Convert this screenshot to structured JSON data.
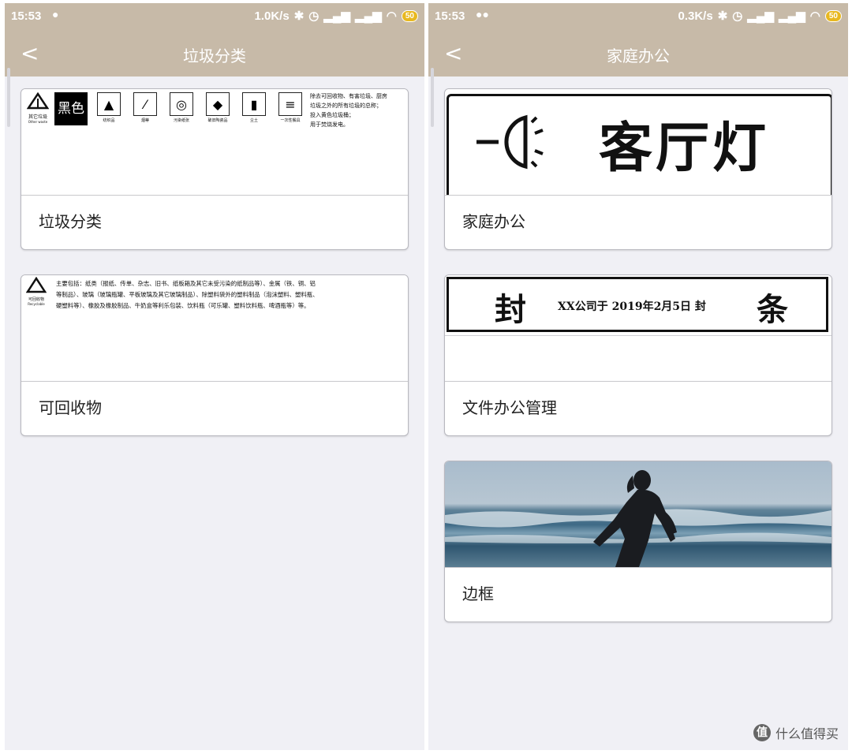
{
  "left": {
    "status": {
      "time": "15:53",
      "speed": "1.0K/s",
      "battery": "50"
    },
    "nav": {
      "title": "垃圾分类",
      "back_glyph": "<"
    },
    "cards": [
      {
        "label": "垃圾分类",
        "image": {
          "badge_text": "黑色",
          "icon_caption": "其它垃圾",
          "icon_caption_en": "Other waste",
          "items": [
            "纺织品",
            "烟蒂",
            "污染纸张",
            "破旧陶瓷品",
            "尘土",
            "一次性餐具"
          ],
          "desc": [
            "除去可回收物、有害垃圾、厨房",
            "垃圾之外的所有垃圾的总称；",
            "投入黄色垃圾桶；",
            "用于焚烧发电。"
          ]
        }
      },
      {
        "label": "可回收物",
        "image": {
          "icon_caption": "可回收物",
          "icon_caption_en": "Recyclable",
          "desc": [
            "主要包括：纸类（报纸、传单、杂志、旧书、纸板箱及其它未受污染的纸制品等）、金属（铁、铜、铝",
            "等制品）、玻璃（玻璃瓶罐、平板玻璃及其它玻璃制品）、除塑料袋外的塑料制品（泡沫塑料、塑料瓶、",
            "硬塑料等）、橡胶及橡胶制品、牛奶盒等利乐包装、饮料瓶（可乐罐、塑料饮料瓶、啤酒瓶等）等。"
          ]
        }
      }
    ]
  },
  "right": {
    "status": {
      "time": "15:53",
      "speed": "0.3K/s",
      "battery": "50"
    },
    "nav": {
      "title": "家庭办公",
      "back_glyph": "<"
    },
    "cards": [
      {
        "label": "家庭办公",
        "image": {
          "big_text": "客厅灯"
        }
      },
      {
        "label": "文件办公管理",
        "image": {
          "seal_left": "封",
          "seal_middle": "XX公司于 2019年2月5日 封",
          "seal_right": "条"
        }
      },
      {
        "label": "边框",
        "image": {}
      }
    ]
  },
  "watermark": {
    "text": "什么值得买",
    "logo": "值"
  }
}
